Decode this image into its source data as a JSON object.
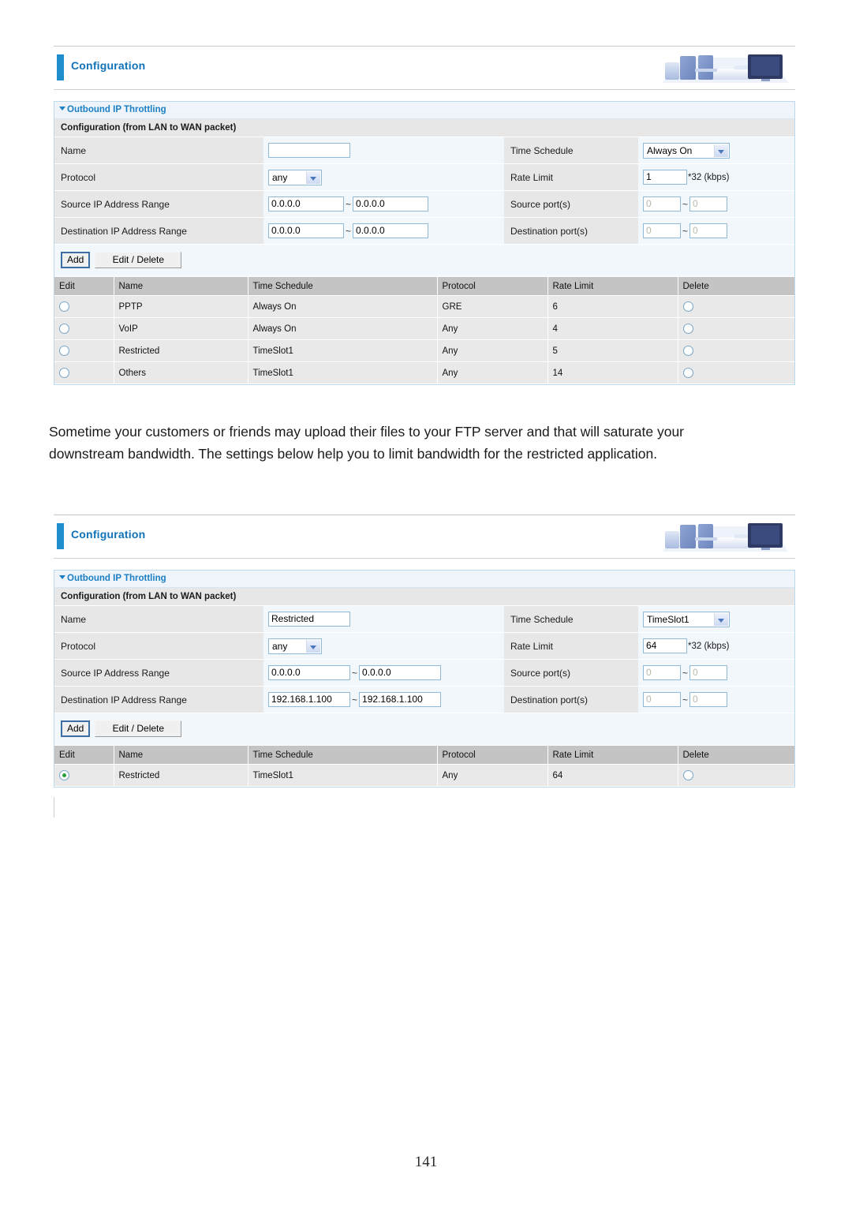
{
  "page": {
    "number": "141",
    "paragraph": "Sometime your customers or friends may upload their files to your FTP server and that will saturate your downstream bandwidth. The settings below help you to limit bandwidth for the restricted application."
  },
  "app": {
    "title": "Configuration",
    "brand_art": "office-workstation-illustration"
  },
  "panel": {
    "title": "Outbound IP Throttling",
    "section_title": "Configuration (from LAN to WAN packet)"
  },
  "labels": {
    "name": "Name",
    "protocol": "Protocol",
    "source_ip_range": "Source IP Address Range",
    "destination_ip_range": "Destination IP Address Range",
    "time_schedule": "Time Schedule",
    "rate_limit": "Rate Limit",
    "source_ports": "Source port(s)",
    "destination_ports": "Destination port(s)",
    "rate_unit": "*32 (kbps)",
    "tilde": "~"
  },
  "buttons": {
    "add": "Add",
    "edit_delete": "Edit / Delete"
  },
  "table_headers": {
    "edit": "Edit",
    "name": "Name",
    "time_schedule": "Time Schedule",
    "protocol": "Protocol",
    "rate_limit": "Rate Limit",
    "delete": "Delete"
  },
  "screen1": {
    "form": {
      "name_value": "",
      "protocol_value": "any",
      "src_ip_from": "0.0.0.0",
      "src_ip_to": "0.0.0.0",
      "dst_ip_from": "0.0.0.0",
      "dst_ip_to": "0.0.0.0",
      "time_schedule_value": "Always On",
      "rate_limit_value": "1",
      "src_port_from": "0",
      "src_port_to": "0",
      "dst_port_from": "0",
      "dst_port_to": "0"
    },
    "rows": [
      {
        "name": "PPTP",
        "time_schedule": "Always On",
        "protocol": "GRE",
        "rate_limit": "6",
        "selected": false
      },
      {
        "name": "VoIP",
        "time_schedule": "Always On",
        "protocol": "Any",
        "rate_limit": "4",
        "selected": false
      },
      {
        "name": "Restricted",
        "time_schedule": "TimeSlot1",
        "protocol": "Any",
        "rate_limit": "5",
        "selected": false
      },
      {
        "name": "Others",
        "time_schedule": "TimeSlot1",
        "protocol": "Any",
        "rate_limit": "14",
        "selected": false
      }
    ]
  },
  "screen2": {
    "form": {
      "name_value": "Restricted",
      "protocol_value": "any",
      "src_ip_from": "0.0.0.0",
      "src_ip_to": "0.0.0.0",
      "dst_ip_from": "192.168.1.100",
      "dst_ip_to": "192.168.1.100",
      "time_schedule_value": "TimeSlot1",
      "rate_limit_value": "64",
      "src_port_from": "0",
      "src_port_to": "0",
      "dst_port_from": "0",
      "dst_port_to": "0"
    },
    "rows": [
      {
        "name": "Restricted",
        "time_schedule": "TimeSlot1",
        "protocol": "Any",
        "rate_limit": "64",
        "selected": true
      }
    ]
  },
  "colors": {
    "accent_blue": "#1f8ccc",
    "title_blue": "#1072b8",
    "panel_border": "#bcd9ec",
    "label_bg": "#e7e7e7",
    "field_bg": "#f2f7fc",
    "table_header_bg": "#c4c4c4",
    "table_row_bg": "#e9e9e9",
    "radio_on": "#2aa53a"
  }
}
